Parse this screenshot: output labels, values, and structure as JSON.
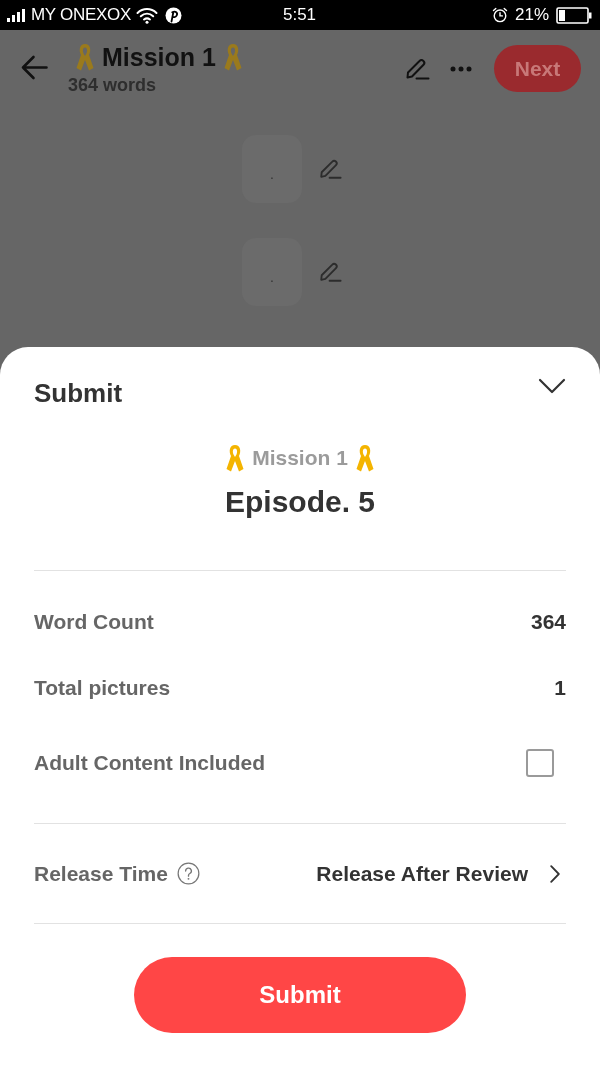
{
  "status_bar": {
    "carrier": "MY ONEXOX",
    "time": "5:51",
    "battery": "21%"
  },
  "header": {
    "title": "Mission 1",
    "subtitle": "364 words",
    "next_button": "Next"
  },
  "content": {
    "blocks": [
      {
        "text": "."
      },
      {
        "text": "."
      }
    ]
  },
  "sheet": {
    "title": "Submit",
    "story": "Mission 1",
    "episode": "Episode. 5",
    "sections": [
      {
        "rows": [
          {
            "kind": "value",
            "label": "Word Count",
            "value": "364"
          },
          {
            "kind": "value",
            "label": "Total pictures",
            "value": "1"
          },
          {
            "kind": "checkbox",
            "label": "Adult Content Included",
            "checked": false
          }
        ]
      },
      {
        "rows": [
          {
            "kind": "picker",
            "label": "Release Time",
            "value": "Release After Review"
          }
        ]
      }
    ],
    "submit_button": "Submit"
  }
}
